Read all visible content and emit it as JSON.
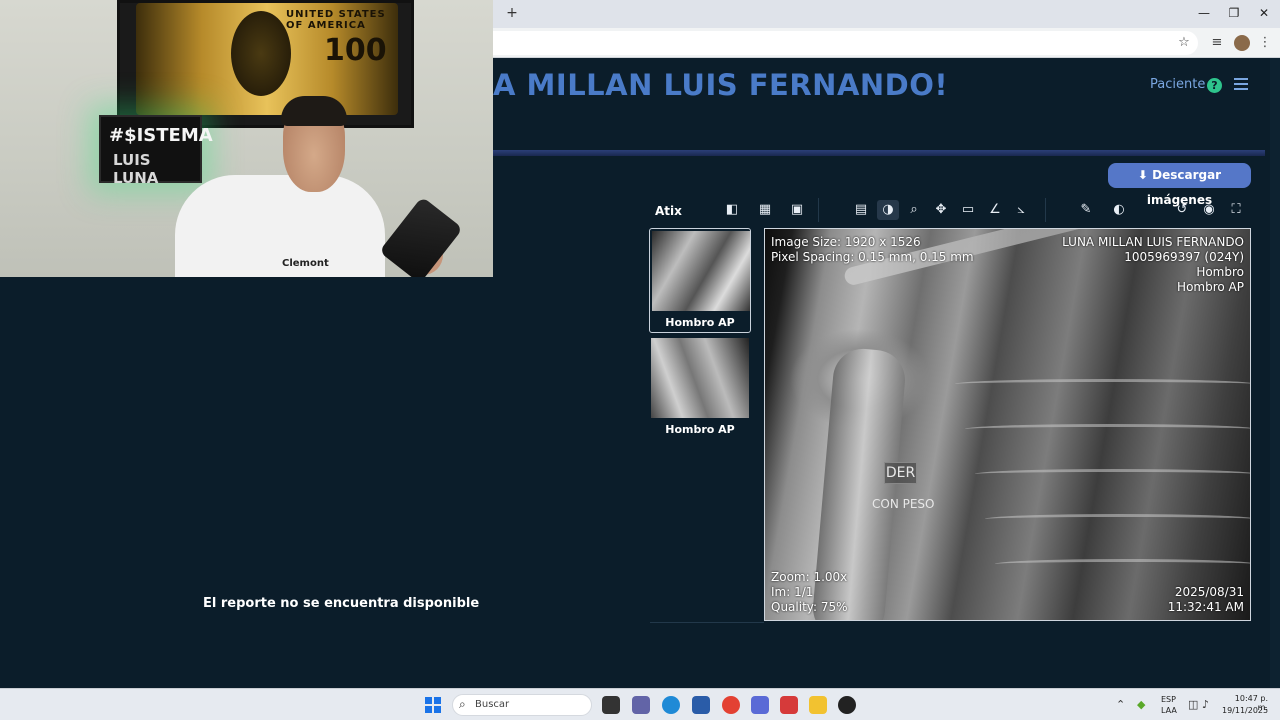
{
  "browser": {
    "new_tab": "+",
    "window_controls": {
      "minimize": "—",
      "maximize": "❐",
      "close": "✕"
    },
    "toolbar_icons": [
      "star-icon",
      "media-icon",
      "profile-avatar",
      "kebab-menu-icon"
    ]
  },
  "header": {
    "greeting": "A MILLAN LUIS FERNANDO!",
    "role": "Paciente",
    "help_glyph": "?"
  },
  "actions": {
    "download": "⬇ Descargar imágenes"
  },
  "viewer": {
    "name": "Atix",
    "tools": [
      "layout-icon",
      "grid-icon",
      "hd-icon",
      "series-icon",
      "window-level-icon",
      "zoom-icon",
      "pan-icon",
      "ruler-icon",
      "angle-icon",
      "cobb-angle-icon",
      "annotate-icon",
      "invert-icon",
      "reset-icon",
      "screenshot-icon",
      "fullscreen-icon"
    ],
    "active_tool": "window-level-icon"
  },
  "thumbnails": [
    {
      "label": "Hombro AP"
    },
    {
      "label": "Hombro AP"
    }
  ],
  "image_overlay": {
    "top_left": [
      "Image Size: 1920 x 1526",
      "Pixel Spacing: 0.15 mm, 0.15 mm"
    ],
    "top_right": [
      "LUNA MILLAN LUIS FERNANDO",
      "1005969397 (024Y)",
      "Hombro",
      "Hombro AP"
    ],
    "bottom_left": [
      "Zoom: 1.00x",
      "Im: 1/1",
      "Quality: 75%"
    ],
    "bottom_right": [
      "2025/08/31",
      "11:32:41 AM"
    ],
    "marker_side": "DER",
    "marker_note": "CON PESO"
  },
  "report": {
    "message": "El reporte no se encuentra disponible"
  },
  "webcam": {
    "poster_text": "UNITED STATES OF AMERICA",
    "poster_number": "100",
    "logo_line1": "#$ISTEMA",
    "logo_line2": "LUIS LUNA",
    "shirt_text": "Clemont"
  },
  "taskbar": {
    "search_placeholder": "Buscar",
    "lang_line1": "ESP",
    "lang_line2": "LAA",
    "time": "10:47 p. m.",
    "date": "19/11/2025",
    "colors": {
      "accent": "#1a73e8"
    }
  },
  "colors": {
    "app_bg": "#0b1d2a",
    "title": "#4a7bc8",
    "button": "#5577c8",
    "help": "#2ec48c"
  }
}
